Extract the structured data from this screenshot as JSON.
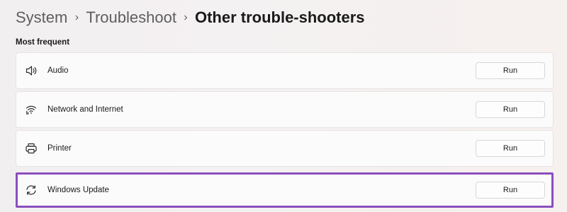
{
  "breadcrumb": {
    "items": [
      "System",
      "Troubleshoot"
    ],
    "current": "Other trouble-shooters",
    "separator": "›"
  },
  "section": {
    "title": "Most frequent"
  },
  "troubleshooters": [
    {
      "label": "Audio",
      "icon": "speaker-icon",
      "button": "Run"
    },
    {
      "label": "Network and Internet",
      "icon": "network-icon",
      "button": "Run"
    },
    {
      "label": "Printer",
      "icon": "printer-icon",
      "button": "Run"
    },
    {
      "label": "Windows Update",
      "icon": "sync-icon",
      "button": "Run",
      "highlighted": true
    }
  ],
  "colors": {
    "highlight": "#8b4fbc",
    "card_background": "#fcfbfb",
    "page_background": "#f3f0f1"
  }
}
